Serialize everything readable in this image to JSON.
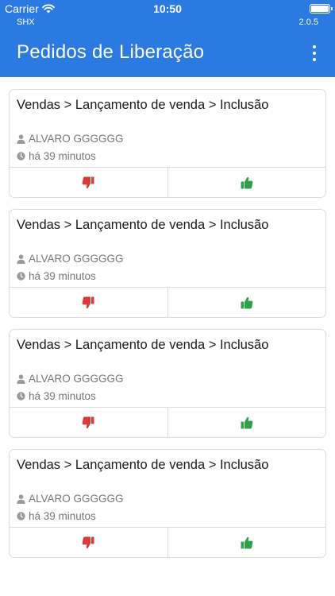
{
  "status_bar": {
    "carrier": "Carrier",
    "time": "10:50"
  },
  "header": {
    "company": "SHX",
    "version": "2.0.5",
    "title": "Pedidos de Liberação"
  },
  "colors": {
    "header_bg": "#2a7ae2",
    "reject": "#d93a3a",
    "approve": "#2fa14a"
  },
  "icons": {
    "menu": "more-vertical-icon",
    "user": "user-icon",
    "time": "clock-icon",
    "reject": "thumbs-down-icon",
    "approve": "thumbs-up-icon"
  },
  "requests": [
    {
      "title": "Vendas > Lançamento de venda > Inclusão",
      "user": "ALVARO GGGGGG",
      "time_ago": "há 39 minutos"
    },
    {
      "title": "Vendas > Lançamento de venda > Inclusão",
      "user": "ALVARO GGGGGG",
      "time_ago": "há 39 minutos"
    },
    {
      "title": "Vendas > Lançamento de venda > Inclusão",
      "user": "ALVARO GGGGGG",
      "time_ago": "há 39 minutos"
    },
    {
      "title": "Vendas > Lançamento de venda > Inclusão",
      "user": "ALVARO GGGGGG",
      "time_ago": "há 39 minutos"
    }
  ]
}
